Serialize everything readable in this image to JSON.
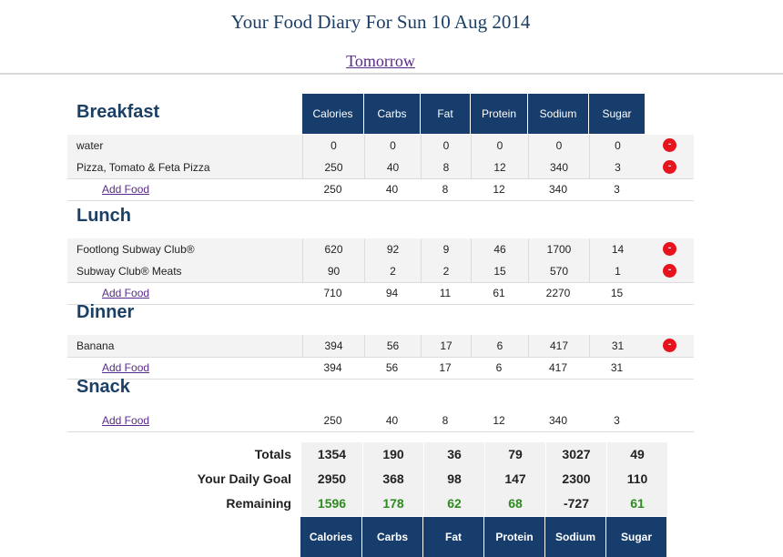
{
  "header": {
    "title": "Your Food Diary For Sun 10 Aug 2014",
    "tomorrow_link": "Tomorrow"
  },
  "columns": [
    "Calories",
    "Carbs",
    "Fat",
    "Protein",
    "Sodium",
    "Sugar"
  ],
  "meals": [
    {
      "name": "Breakfast",
      "items": [
        {
          "food": "water",
          "values": [
            "0",
            "0",
            "0",
            "0",
            "0",
            "0"
          ]
        },
        {
          "food": "Pizza, Tomato & Feta Pizza",
          "values": [
            "250",
            "40",
            "8",
            "12",
            "340",
            "3"
          ]
        }
      ],
      "add_label": "Add Food",
      "subtotal": [
        "250",
        "40",
        "8",
        "12",
        "340",
        "3"
      ]
    },
    {
      "name": "Lunch",
      "items": [
        {
          "food": "Footlong Subway Club®",
          "values": [
            "620",
            "92",
            "9",
            "46",
            "1700",
            "14"
          ]
        },
        {
          "food": "Subway Club® Meats",
          "values": [
            "90",
            "2",
            "2",
            "15",
            "570",
            "1"
          ]
        }
      ],
      "add_label": "Add Food",
      "subtotal": [
        "710",
        "94",
        "11",
        "61",
        "2270",
        "15"
      ]
    },
    {
      "name": "Dinner",
      "items": [
        {
          "food": "Banana",
          "values": [
            "394",
            "56",
            "17",
            "6",
            "417",
            "31"
          ]
        }
      ],
      "add_label": "Add Food",
      "subtotal": [
        "394",
        "56",
        "17",
        "6",
        "417",
        "31"
      ]
    },
    {
      "name": "Snack",
      "items": [],
      "add_label": "Add Food",
      "subtotal": [
        "250",
        "40",
        "8",
        "12",
        "340",
        "3"
      ]
    }
  ],
  "delete_symbol": "-",
  "summary": [
    {
      "label": "Totals",
      "values": [
        "1354",
        "190",
        "36",
        "79",
        "3027",
        "49"
      ]
    },
    {
      "label": "Your Daily Goal",
      "values": [
        "2950",
        "368",
        "98",
        "147",
        "2300",
        "110"
      ]
    },
    {
      "label": "Remaining",
      "values": [
        "1596",
        "178",
        "62",
        "68",
        "-727",
        "61"
      ]
    }
  ],
  "colors": {
    "header_bg": "#163d6c",
    "remaining_green": "#2e8b1f",
    "delete_red": "#e8141d"
  }
}
